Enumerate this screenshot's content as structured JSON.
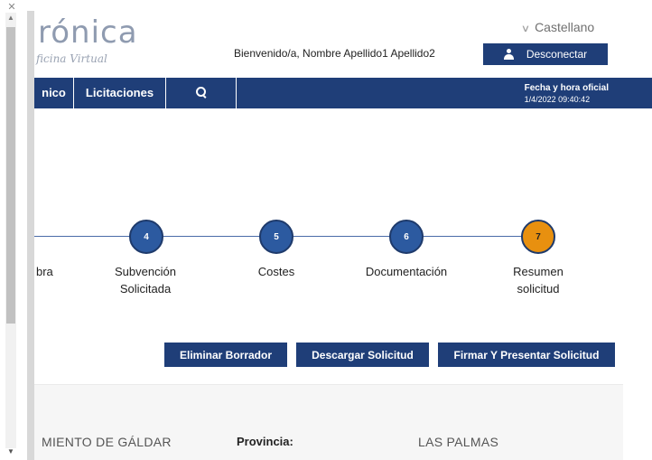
{
  "header": {
    "logo_text": "rónica",
    "logo_subtitle": "ficina Virtual",
    "welcome_text": "Bienvenido/a, Nombre Apellido1 Apellido2",
    "language": "Castellano",
    "logout_label": "Desconectar"
  },
  "nav": {
    "items": [
      {
        "label": "nico"
      },
      {
        "label": "Licitaciones"
      }
    ],
    "search_icon": "search-icon",
    "datetime_label": "Fecha y hora oficial",
    "datetime_value": "1/4/2022 09:40:42"
  },
  "steps": [
    {
      "number": "",
      "label": "bra",
      "label2": ""
    },
    {
      "number": "4",
      "label": "Subvención",
      "label2": "Solicitada"
    },
    {
      "number": "5",
      "label": "Costes",
      "label2": ""
    },
    {
      "number": "6",
      "label": "Documentación",
      "label2": ""
    },
    {
      "number": "7",
      "label": "Resumen",
      "label2": "solicitud"
    }
  ],
  "actions": {
    "delete_label": "Eliminar Borrador",
    "download_label": "Descargar Solicitud",
    "sign_label": "Firmar Y Presentar Solicitud"
  },
  "details": {
    "municipality": "MIENTO DE GÁLDAR",
    "province_label": "Provincia:",
    "province_value": "LAS PALMAS"
  },
  "colors": {
    "navy": "#1f3e78",
    "step_blue": "#2c5aa0",
    "step_active": "#e8900f"
  }
}
